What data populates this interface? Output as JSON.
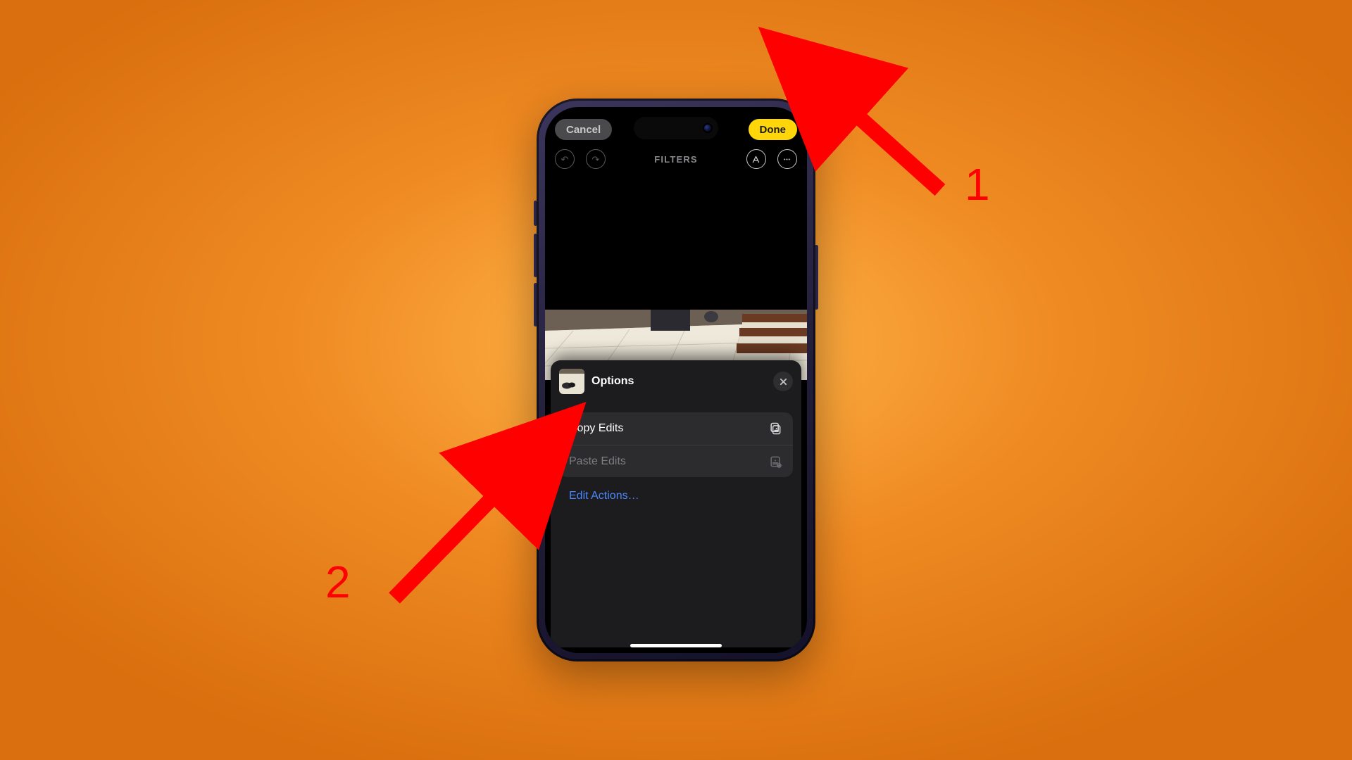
{
  "header": {
    "cancel_label": "Cancel",
    "done_label": "Done",
    "section_title": "FILTERS"
  },
  "sheet": {
    "title": "Options",
    "rows": {
      "copy": "Copy Edits",
      "paste": "Paste Edits"
    },
    "edit_actions_label": "Edit Actions…"
  },
  "annotations": {
    "one": "1",
    "two": "2"
  }
}
